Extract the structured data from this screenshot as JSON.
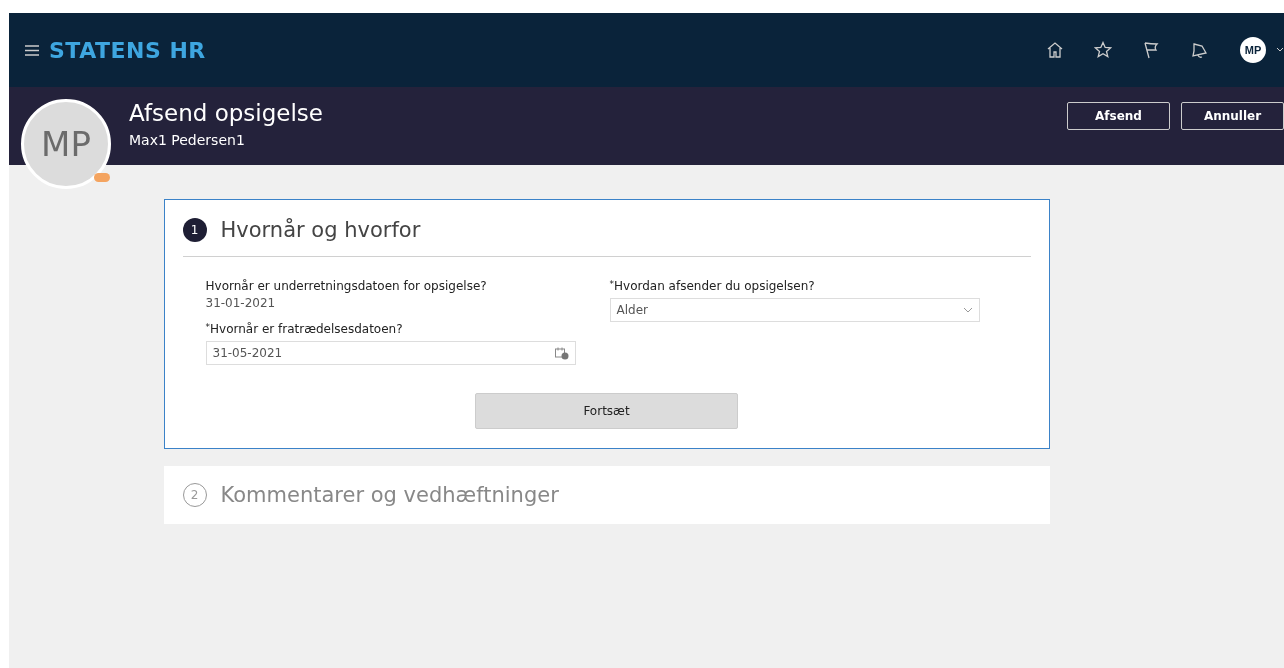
{
  "app": {
    "brand": "STATENS HR",
    "user_initials": "MP"
  },
  "page_header": {
    "avatar_initials": "MP",
    "title": "Afsend opsigelse",
    "subtitle": "Max1 Pedersen1",
    "buttons": [
      "Afsend",
      "Annuller"
    ]
  },
  "steps": [
    {
      "number": "1",
      "title": "Hvornår og hvorfor",
      "expanded": true,
      "notice_date": {
        "label": "Hvornår er underretningsdatoen for opsigelse?",
        "value": "31-01-2021"
      },
      "leave_date": {
        "required_mark": "*",
        "label": "Hvornår er fratrædelsesdatoen?",
        "value": "31-05-2021"
      },
      "method": {
        "required_mark": "*",
        "label": "Hvordan afsender du opsigelsen?",
        "value": "Alder"
      },
      "continue_button": "Fortsæt"
    },
    {
      "number": "2",
      "title": "Kommentarer og vedhæftninger",
      "expanded": false
    }
  ]
}
